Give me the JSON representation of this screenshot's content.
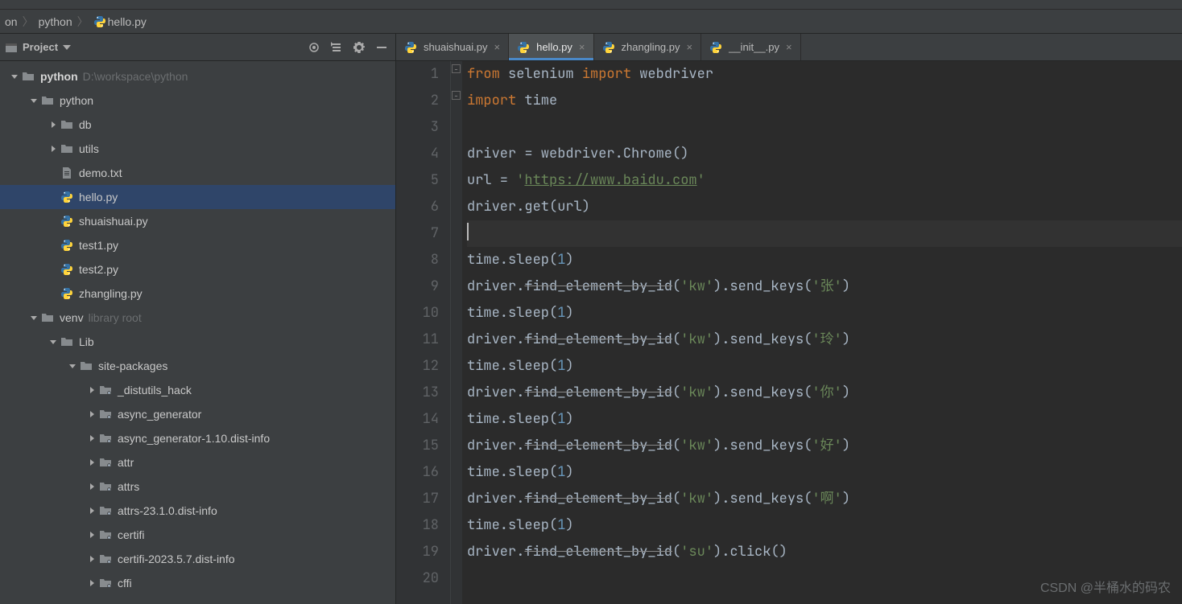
{
  "breadcrumb": {
    "items": [
      "on",
      "python",
      "hello.py"
    ]
  },
  "project_toolwindow": {
    "title": "Project"
  },
  "tree": {
    "root": {
      "name": "python",
      "path": "D:\\workspace\\python"
    },
    "nodes": [
      {
        "depth": 0,
        "kind": "root",
        "label": "python",
        "hint": "D:\\workspace\\python",
        "expanded": true,
        "bold": true
      },
      {
        "depth": 1,
        "kind": "dir",
        "label": "python",
        "expanded": true
      },
      {
        "depth": 2,
        "kind": "dir",
        "label": "db",
        "expanded": false,
        "arrow": true
      },
      {
        "depth": 2,
        "kind": "dir",
        "label": "utils",
        "expanded": false,
        "arrow": true
      },
      {
        "depth": 2,
        "kind": "file",
        "label": "demo.txt",
        "icon": "txt"
      },
      {
        "depth": 2,
        "kind": "file",
        "label": "hello.py",
        "icon": "py",
        "selected": true
      },
      {
        "depth": 2,
        "kind": "file",
        "label": "shuaishuai.py",
        "icon": "py"
      },
      {
        "depth": 2,
        "kind": "file",
        "label": "test1.py",
        "icon": "py"
      },
      {
        "depth": 2,
        "kind": "file",
        "label": "test2.py",
        "icon": "py"
      },
      {
        "depth": 2,
        "kind": "file",
        "label": "zhangling.py",
        "icon": "py"
      },
      {
        "depth": 1,
        "kind": "dir",
        "label": "venv",
        "hint": "library root",
        "expanded": true
      },
      {
        "depth": 2,
        "kind": "dir",
        "label": "Lib",
        "expanded": true
      },
      {
        "depth": 3,
        "kind": "dir",
        "label": "site-packages",
        "expanded": true
      },
      {
        "depth": 4,
        "kind": "dirdot",
        "label": "_distutils_hack",
        "arrow": true
      },
      {
        "depth": 4,
        "kind": "dirdot",
        "label": "async_generator",
        "arrow": true
      },
      {
        "depth": 4,
        "kind": "dirdot",
        "label": "async_generator-1.10.dist-info",
        "arrow": true
      },
      {
        "depth": 4,
        "kind": "dirdot",
        "label": "attr",
        "arrow": true
      },
      {
        "depth": 4,
        "kind": "dirdot",
        "label": "attrs",
        "arrow": true
      },
      {
        "depth": 4,
        "kind": "dirdot",
        "label": "attrs-23.1.0.dist-info",
        "arrow": true
      },
      {
        "depth": 4,
        "kind": "dirdot",
        "label": "certifi",
        "arrow": true
      },
      {
        "depth": 4,
        "kind": "dirdot",
        "label": "certifi-2023.5.7.dist-info",
        "arrow": true
      },
      {
        "depth": 4,
        "kind": "dirdot",
        "label": "cffi",
        "arrow": true
      }
    ]
  },
  "tabs": [
    {
      "label": "shuaishuai.py",
      "active": false
    },
    {
      "label": "hello.py",
      "active": true
    },
    {
      "label": "zhangling.py",
      "active": false
    },
    {
      "label": "__init__.py",
      "active": false
    }
  ],
  "editor": {
    "active_file": "hello.py",
    "cursor_line": 7,
    "code": {
      "l1": {
        "from": "from",
        "mod": "selenium",
        "import": "import",
        "name": "webdriver"
      },
      "l2": {
        "import": "import",
        "name": "time"
      },
      "l4": "driver = webdriver.Chrome()",
      "l5": {
        "pre": "url = ",
        "q1": "'",
        "url": "https://www.baidu.com",
        "q2": "'"
      },
      "l6": "driver.get(url)",
      "l8": {
        "pre": "time.sleep(",
        "num": "1",
        "post": ")"
      },
      "l9": {
        "pre": "driver.",
        "dep": "find_element_by_id",
        "mid": "(",
        "s1": "'kw'",
        "mid2": ").send_keys(",
        "s2": "'张'",
        "end": ")"
      },
      "l10": {
        "pre": "time.sleep(",
        "num": "1",
        "post": ")"
      },
      "l11": {
        "pre": "driver.",
        "dep": "find_element_by_id",
        "mid": "(",
        "s1": "'kw'",
        "mid2": ").send_keys(",
        "s2": "'玲'",
        "end": ")"
      },
      "l12": {
        "pre": "time.sleep(",
        "num": "1",
        "post": ")"
      },
      "l13": {
        "pre": "driver.",
        "dep": "find_element_by_id",
        "mid": "(",
        "s1": "'kw'",
        "mid2": ").send_keys(",
        "s2": "'你'",
        "end": ")"
      },
      "l14": {
        "pre": "time.sleep(",
        "num": "1",
        "post": ")"
      },
      "l15": {
        "pre": "driver.",
        "dep": "find_element_by_id",
        "mid": "(",
        "s1": "'kw'",
        "mid2": ").send_keys(",
        "s2": "'好'",
        "end": ")"
      },
      "l16": {
        "pre": "time.sleep(",
        "num": "1",
        "post": ")"
      },
      "l17": {
        "pre": "driver.",
        "dep": "find_element_by_id",
        "mid": "(",
        "s1": "'kw'",
        "mid2": ").send_keys(",
        "s2": "'啊'",
        "end": ")"
      },
      "l18": {
        "pre": "time.sleep(",
        "num": "1",
        "post": ")"
      },
      "l19": {
        "pre": "driver.",
        "dep": "find_element_by_id",
        "mid": "(",
        "s1": "'su'",
        "mid2": ").click()",
        "s2": "",
        "end": ""
      }
    },
    "line_numbers": [
      "1",
      "2",
      "3",
      "4",
      "5",
      "6",
      "7",
      "8",
      "9",
      "10",
      "11",
      "12",
      "13",
      "14",
      "15",
      "16",
      "17",
      "18",
      "19",
      "20"
    ]
  },
  "watermark": "CSDN @半桶水的码农"
}
